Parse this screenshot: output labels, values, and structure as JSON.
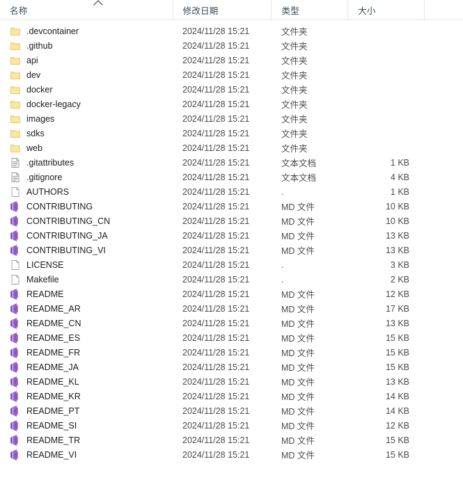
{
  "window": {
    "view": "details"
  },
  "columns": {
    "name": "名称",
    "date_modified": "修改日期",
    "type": "类型",
    "size": "大小",
    "sort_indicator": "sort-ascending-chevron",
    "sorted_by": "名称"
  },
  "types": {
    "folder": "文件夹",
    "text_document": "文本文档",
    "generic": ".",
    "md_file": "MD 文件"
  },
  "colors": {
    "folder": "#fbe6a2",
    "folder_border": "#e8c86a",
    "md_icon": "#8a56c2",
    "page": "#ffffff",
    "page_border": "#9aa0a6",
    "header_text": "#3b4a57",
    "row_text": "#222222",
    "secondary_text": "#4a4a4a",
    "divider": "#e8e8e8"
  },
  "rows": [
    {
      "name": ".devcontainer",
      "icon": "folder-icon",
      "date": "2024/11/28 15:21",
      "type": "文件夹",
      "size": ""
    },
    {
      "name": ".github",
      "icon": "folder-icon",
      "date": "2024/11/28 15:21",
      "type": "文件夹",
      "size": ""
    },
    {
      "name": "api",
      "icon": "folder-icon",
      "date": "2024/11/28 15:21",
      "type": "文件夹",
      "size": ""
    },
    {
      "name": "dev",
      "icon": "folder-icon",
      "date": "2024/11/28 15:21",
      "type": "文件夹",
      "size": ""
    },
    {
      "name": "docker",
      "icon": "folder-icon",
      "date": "2024/11/28 15:21",
      "type": "文件夹",
      "size": ""
    },
    {
      "name": "docker-legacy",
      "icon": "folder-icon",
      "date": "2024/11/28 15:21",
      "type": "文件夹",
      "size": ""
    },
    {
      "name": "images",
      "icon": "folder-icon",
      "date": "2024/11/28 15:21",
      "type": "文件夹",
      "size": ""
    },
    {
      "name": "sdks",
      "icon": "folder-icon",
      "date": "2024/11/28 15:21",
      "type": "文件夹",
      "size": ""
    },
    {
      "name": "web",
      "icon": "folder-icon",
      "date": "2024/11/28 15:21",
      "type": "文件夹",
      "size": ""
    },
    {
      "name": ".gitattributes",
      "icon": "text-file-icon",
      "date": "2024/11/28 15:21",
      "type": "文本文档",
      "size": "1 KB"
    },
    {
      "name": ".gitignore",
      "icon": "text-file-icon",
      "date": "2024/11/28 15:21",
      "type": "文本文档",
      "size": "4 KB"
    },
    {
      "name": "AUTHORS",
      "icon": "blank-page-icon",
      "date": "2024/11/28 15:21",
      "type": ".",
      "size": "1 KB"
    },
    {
      "name": "CONTRIBUTING",
      "icon": "markdown-vs-icon",
      "date": "2024/11/28 15:21",
      "type": "MD 文件",
      "size": "10 KB"
    },
    {
      "name": "CONTRIBUTING_CN",
      "icon": "markdown-vs-icon",
      "date": "2024/11/28 15:21",
      "type": "MD 文件",
      "size": "10 KB"
    },
    {
      "name": "CONTRIBUTING_JA",
      "icon": "markdown-vs-icon",
      "date": "2024/11/28 15:21",
      "type": "MD 文件",
      "size": "13 KB"
    },
    {
      "name": "CONTRIBUTING_VI",
      "icon": "markdown-vs-icon",
      "date": "2024/11/28 15:21",
      "type": "MD 文件",
      "size": "13 KB"
    },
    {
      "name": "LICENSE",
      "icon": "blank-page-icon",
      "date": "2024/11/28 15:21",
      "type": ".",
      "size": "3 KB"
    },
    {
      "name": "Makefile",
      "icon": "blank-page-icon",
      "date": "2024/11/28 15:21",
      "type": ".",
      "size": "2 KB"
    },
    {
      "name": "README",
      "icon": "markdown-vs-icon",
      "date": "2024/11/28 15:21",
      "type": "MD 文件",
      "size": "12 KB"
    },
    {
      "name": "README_AR",
      "icon": "markdown-vs-icon",
      "date": "2024/11/28 15:21",
      "type": "MD 文件",
      "size": "17 KB"
    },
    {
      "name": "README_CN",
      "icon": "markdown-vs-icon",
      "date": "2024/11/28 15:21",
      "type": "MD 文件",
      "size": "13 KB"
    },
    {
      "name": "README_ES",
      "icon": "markdown-vs-icon",
      "date": "2024/11/28 15:21",
      "type": "MD 文件",
      "size": "15 KB"
    },
    {
      "name": "README_FR",
      "icon": "markdown-vs-icon",
      "date": "2024/11/28 15:21",
      "type": "MD 文件",
      "size": "15 KB"
    },
    {
      "name": "README_JA",
      "icon": "markdown-vs-icon",
      "date": "2024/11/28 15:21",
      "type": "MD 文件",
      "size": "15 KB"
    },
    {
      "name": "README_KL",
      "icon": "markdown-vs-icon",
      "date": "2024/11/28 15:21",
      "type": "MD 文件",
      "size": "13 KB"
    },
    {
      "name": "README_KR",
      "icon": "markdown-vs-icon",
      "date": "2024/11/28 15:21",
      "type": "MD 文件",
      "size": "14 KB"
    },
    {
      "name": "README_PT",
      "icon": "markdown-vs-icon",
      "date": "2024/11/28 15:21",
      "type": "MD 文件",
      "size": "14 KB"
    },
    {
      "name": "README_SI",
      "icon": "markdown-vs-icon",
      "date": "2024/11/28 15:21",
      "type": "MD 文件",
      "size": "12 KB"
    },
    {
      "name": "README_TR",
      "icon": "markdown-vs-icon",
      "date": "2024/11/28 15:21",
      "type": "MD 文件",
      "size": "15 KB"
    },
    {
      "name": "README_VI",
      "icon": "markdown-vs-icon",
      "date": "2024/11/28 15:21",
      "type": "MD 文件",
      "size": "15 KB"
    }
  ]
}
